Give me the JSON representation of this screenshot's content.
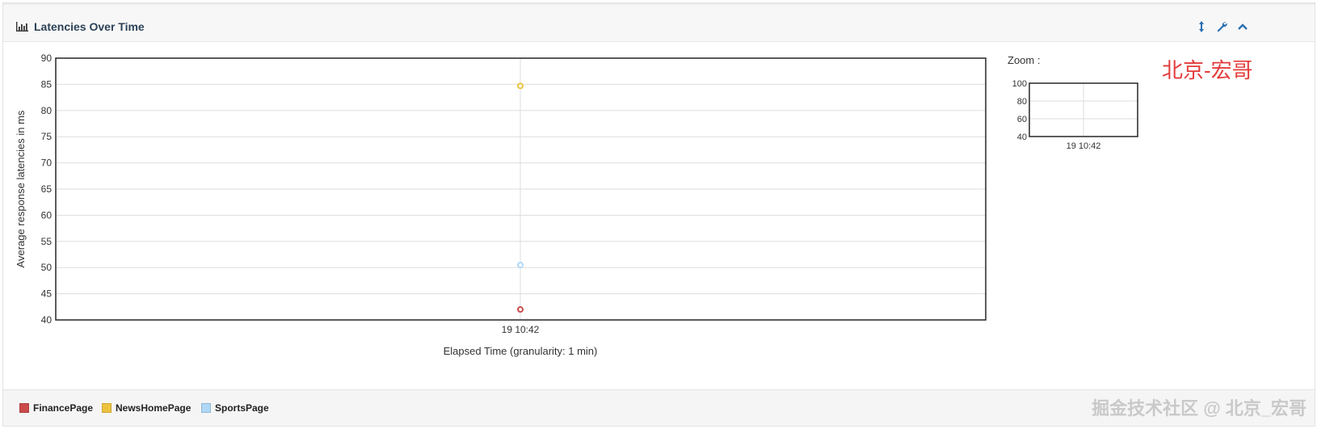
{
  "panel": {
    "title": "Latencies Over Time",
    "tools": [
      "resize-icon",
      "wrench-icon",
      "chevron-up-icon"
    ]
  },
  "watermarks": {
    "top": "北京-宏哥",
    "footer": "掘金技术社区 @ 北京_宏哥"
  },
  "zoom": {
    "label": "Zoom :"
  },
  "legend": [
    {
      "name": "FinancePage",
      "color": "#cb4b4b"
    },
    {
      "name": "NewsHomePage",
      "color": "#edc240"
    },
    {
      "name": "SportsPage",
      "color": "#afd8f8"
    }
  ],
  "chart_data": [
    {
      "type": "scatter",
      "title": "",
      "xlabel": "Elapsed Time (granularity: 1 min)",
      "ylabel": "Average response latencies in ms",
      "x_ticks": [
        "19 10:42"
      ],
      "ylim": [
        40,
        90
      ],
      "y_ticks": [
        40,
        45,
        50,
        55,
        60,
        65,
        70,
        75,
        80,
        85,
        90
      ],
      "grid": true,
      "legend_position": "bottom",
      "series": [
        {
          "name": "FinancePage",
          "color": "#cb4b4b",
          "points": [
            {
              "x": "19 10:42",
              "y": 42
            }
          ]
        },
        {
          "name": "NewsHomePage",
          "color": "#edc240",
          "points": [
            {
              "x": "19 10:42",
              "y": 84.7
            }
          ]
        },
        {
          "name": "SportsPage",
          "color": "#afd8f8",
          "points": [
            {
              "x": "19 10:42",
              "y": 50.5
            }
          ]
        }
      ]
    },
    {
      "type": "scatter",
      "title": "Zoom",
      "x_ticks": [
        "19 10:42"
      ],
      "ylim": [
        40,
        100
      ],
      "y_ticks": [
        40,
        60,
        80,
        100
      ],
      "grid": true
    }
  ]
}
